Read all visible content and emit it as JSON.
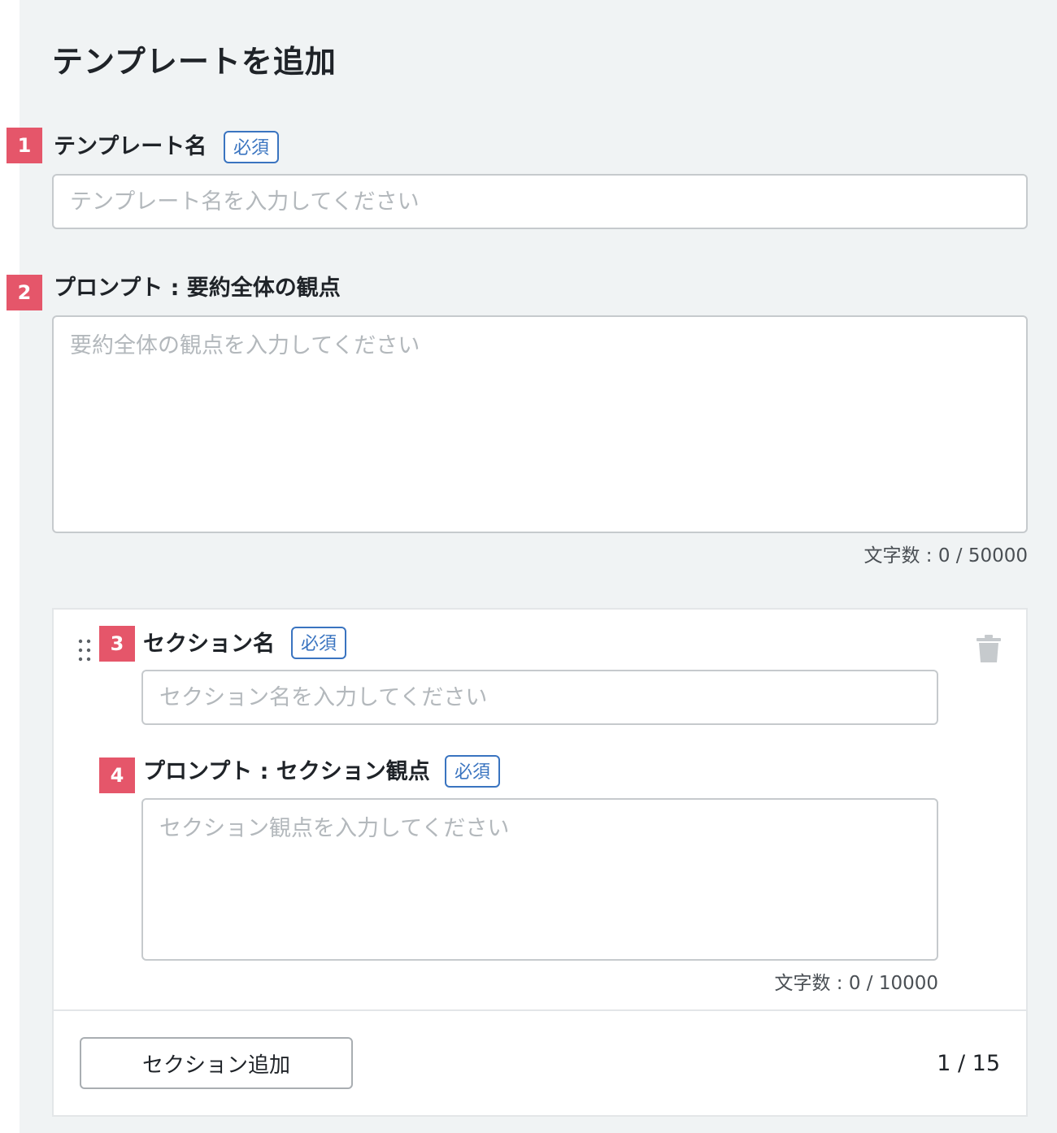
{
  "page": {
    "title": "テンプレートを追加"
  },
  "template_name": {
    "marker": "1",
    "label": "テンプレート名",
    "required_badge": "必須",
    "placeholder": "テンプレート名を入力してください",
    "value": ""
  },
  "overall_prompt": {
    "marker": "2",
    "label": "プロンプト : 要約全体の観点",
    "placeholder": "要約全体の観点を入力してください",
    "value": "",
    "char_count": "文字数 : 0 / 50000"
  },
  "section": {
    "name": {
      "marker": "3",
      "label": "セクション名",
      "required_badge": "必須",
      "placeholder": "セクション名を入力してください",
      "value": ""
    },
    "prompt": {
      "marker": "4",
      "label": "プロンプト : セクション観点",
      "required_badge": "必須",
      "placeholder": "セクション観点を入力してください",
      "value": "",
      "char_count": "文字数 : 0 / 10000"
    },
    "drag_handle_icon": "drag-handle-icon",
    "delete_icon": "trash-icon"
  },
  "footer": {
    "add_section_label": "セクション追加",
    "section_count": "1 / 15"
  },
  "colors": {
    "marker": "#e5566a",
    "badge": "#3a74c0",
    "panel_background": "#f0f3f4",
    "placeholder": "#b3b8bc"
  }
}
